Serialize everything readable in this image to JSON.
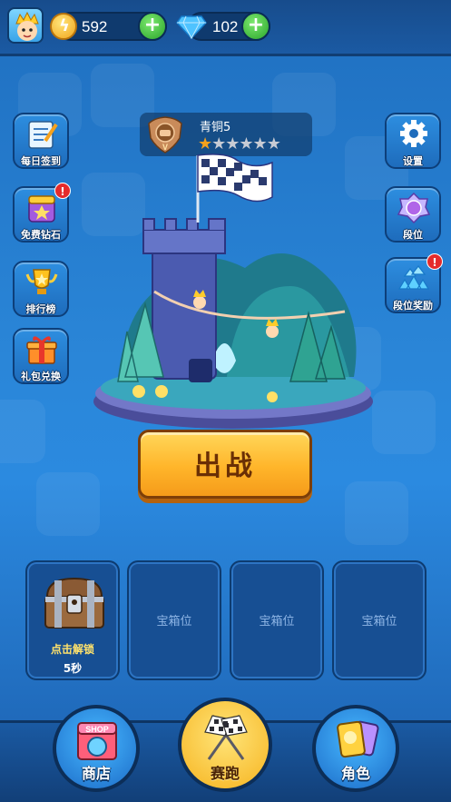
{
  "header": {
    "coins": "592",
    "gems": "102"
  },
  "rank": {
    "name": "青铜5",
    "stars_filled": 1,
    "stars_total": 6
  },
  "left_menu": [
    "每日签到",
    "免费钻石",
    "排行榜",
    "礼包兑换"
  ],
  "right_menu": [
    "设置",
    "段位",
    "段位奖励"
  ],
  "badges": {
    "alert": "!"
  },
  "battle_button": "出战",
  "chest_slots": [
    {
      "label": "点击解锁",
      "timer": "5秒"
    },
    {
      "label": "宝箱位"
    },
    {
      "label": "宝箱位"
    },
    {
      "label": "宝箱位"
    }
  ],
  "nav": {
    "shop": "商店",
    "shop_sign": "SHOP",
    "race": "赛跑",
    "character": "角色"
  },
  "colors": {
    "accent": "#ffb52a",
    "background": "#2a86d8",
    "badge": "#e52b2b"
  }
}
